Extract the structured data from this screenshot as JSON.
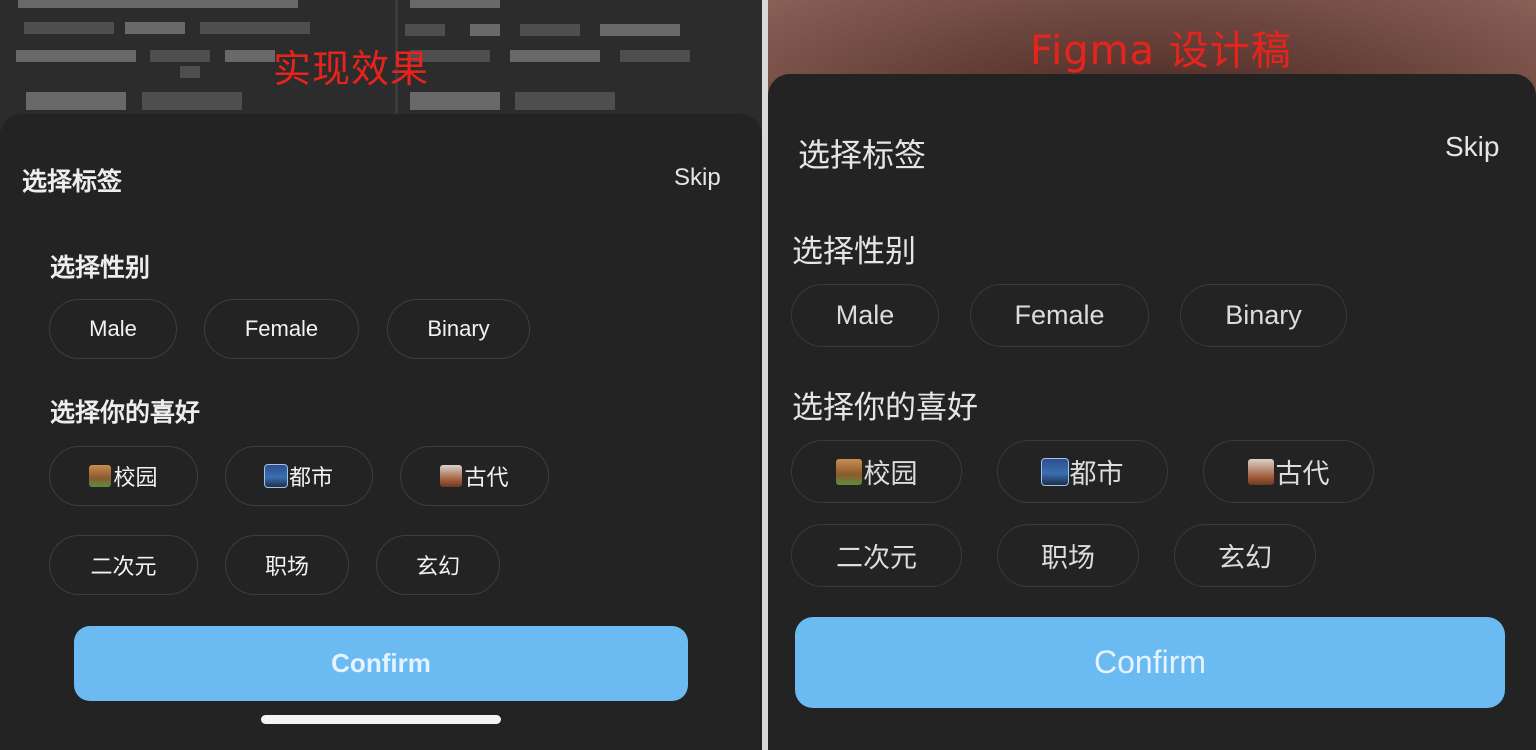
{
  "captions": {
    "left": "实现效果",
    "right": "Figma 设计稿"
  },
  "sheet": {
    "title": "选择标签",
    "skip": "Skip",
    "gender_section": "选择性别",
    "gender_options": [
      "Male",
      "Female",
      "Binary"
    ],
    "preference_section": "选择你的喜好",
    "preference_options": [
      {
        "label": "校园",
        "icon": "school-emoji-icon"
      },
      {
        "label": "都市",
        "icon": "cityscape-emoji-icon"
      },
      {
        "label": "古代",
        "icon": "castle-emoji-icon"
      },
      {
        "label": "二次元",
        "icon": ""
      },
      {
        "label": "职场",
        "icon": ""
      },
      {
        "label": "玄幻",
        "icon": ""
      }
    ],
    "confirm": "Confirm"
  },
  "colors": {
    "caption": "#e8231c",
    "confirm_bg": "#6bbbf2",
    "sheet_bg": "#232323",
    "chip_border": "#3e3e3e"
  }
}
